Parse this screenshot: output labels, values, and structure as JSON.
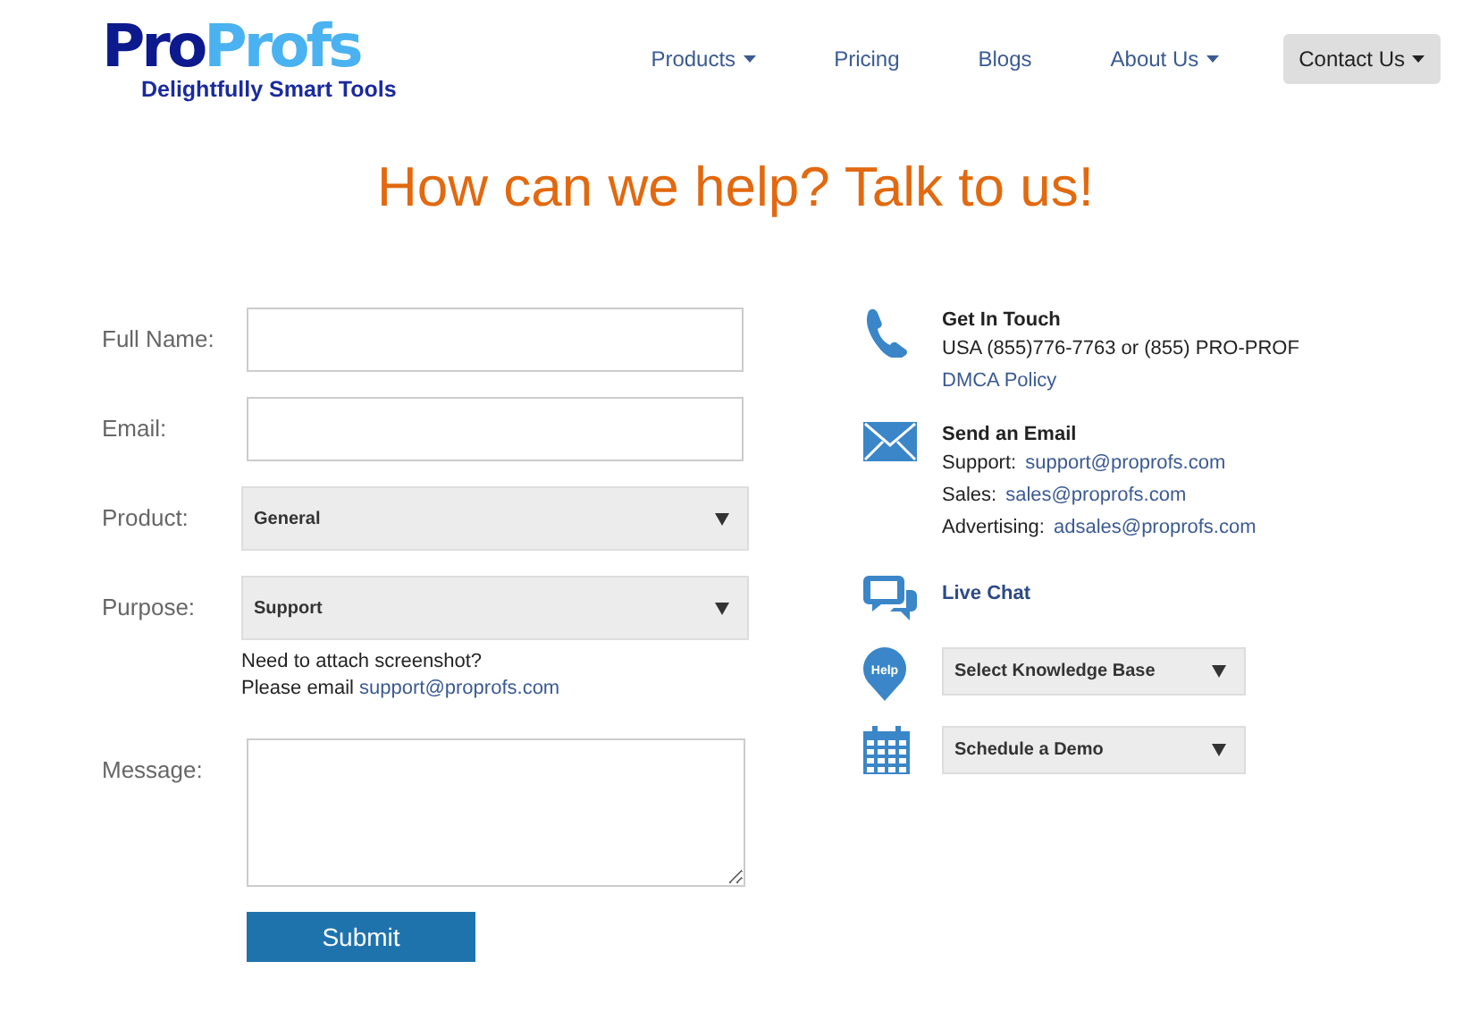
{
  "logo": {
    "brand_dark": "Pro",
    "brand_light": "Profs",
    "tagline": "Delightfully Smart Tools"
  },
  "nav": [
    {
      "label": "Products",
      "has_menu": true,
      "selected": false
    },
    {
      "label": "Pricing",
      "has_menu": false,
      "selected": false
    },
    {
      "label": "Blogs",
      "has_menu": false,
      "selected": false
    },
    {
      "label": "About Us",
      "has_menu": true,
      "selected": false
    },
    {
      "label": "Contact Us",
      "has_menu": true,
      "selected": true
    }
  ],
  "heading": "How can we help? Talk to us!",
  "form": {
    "fields": [
      {
        "kind": "text",
        "label": "Full Name:"
      },
      {
        "kind": "text",
        "label": "Email:"
      },
      {
        "kind": "select",
        "label": "Product:",
        "value": "General"
      },
      {
        "kind": "select",
        "label": "Purpose:",
        "value": "Support"
      },
      {
        "kind": "textarea",
        "label": "Message:"
      }
    ],
    "attach_note": "Need to attach screenshot?",
    "attach_prefix": "Please email ",
    "attach_link": "support@proprofs.com",
    "submit": "Submit"
  },
  "contact": [
    {
      "kind": "phone",
      "title": "Get In Touch",
      "lines": [
        {
          "text": "USA (855)776-7763 or (855) PRO-PROF"
        },
        {
          "link": "DMCA Policy"
        }
      ]
    },
    {
      "kind": "email",
      "title": "Send an Email",
      "lines": [
        {
          "text": "Support:",
          "link": "support@proprofs.com"
        },
        {
          "text": "Sales:",
          "link": "sales@proprofs.com"
        },
        {
          "text": "Advertising:",
          "link": "adsales@proprofs.com"
        }
      ]
    },
    {
      "kind": "chat",
      "link_title": "Live Chat"
    },
    {
      "kind": "help",
      "select": "Select Knowledge Base",
      "icon_text": "Help"
    },
    {
      "kind": "calendar",
      "select": "Schedule a Demo"
    }
  ]
}
